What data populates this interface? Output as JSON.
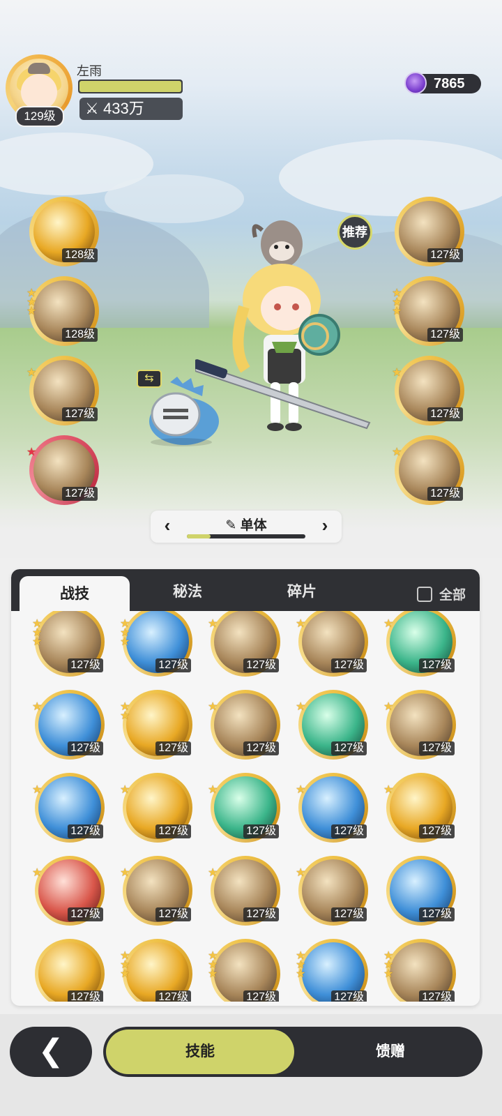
{
  "player": {
    "name": "左雨",
    "level": "129级",
    "hp_fraction": 1.0,
    "power": "433万",
    "power_icon": "crossed-swords-icon"
  },
  "currency": {
    "value": "7865",
    "icon": "purple-gem-icon"
  },
  "recommend_label": "推荐",
  "left_skills": [
    {
      "level": "128级",
      "stars": 0,
      "icon": "golden-crystal-icon",
      "frame": "gold"
    },
    {
      "level": "128级",
      "stars": 3,
      "icon": "fire-swirl-icon",
      "frame": "gold"
    },
    {
      "level": "127级",
      "stars": 1,
      "icon": "dash-strike-icon",
      "frame": "gold"
    },
    {
      "level": "127级",
      "stars": 1,
      "icon": "whirlwind-icon",
      "frame": "red"
    }
  ],
  "right_skills": [
    {
      "level": "127级",
      "stars": 0,
      "icon": "ring-guard-icon"
    },
    {
      "level": "127级",
      "stars": 3,
      "icon": "beast-claw-icon"
    },
    {
      "level": "127级",
      "stars": 1,
      "icon": "fist-strike-icon"
    },
    {
      "level": "127级",
      "stars": 1,
      "icon": "stone-fist-icon"
    }
  ],
  "mode": {
    "label": "单体",
    "progress": 0.2,
    "edit_icon": "pencil-icon"
  },
  "tabs": [
    {
      "label": "战技",
      "active": true
    },
    {
      "label": "秘法",
      "active": false
    },
    {
      "label": "碎片",
      "active": false
    }
  ],
  "all_toggle_label": "全部",
  "grid_skills": [
    {
      "level": "127级",
      "stars": 3,
      "icon": "crushing-pillar-icon",
      "tone": "brown"
    },
    {
      "level": "127级",
      "stars": 3,
      "icon": "blue-rune-ring-icon",
      "tone": "blue"
    },
    {
      "level": "127级",
      "stars": 1,
      "icon": "sand-slash-icon",
      "tone": "brown"
    },
    {
      "level": "127级",
      "stars": 1,
      "icon": "spiral-wind-icon",
      "tone": "brown"
    },
    {
      "level": "127级",
      "stars": 1,
      "icon": "green-web-icon",
      "tone": "green"
    },
    {
      "level": "127级",
      "stars": 1,
      "icon": "ice-burst-icon",
      "tone": "blue"
    },
    {
      "level": "127级",
      "stars": 2,
      "icon": "golden-blade-icon",
      "tone": "gold"
    },
    {
      "level": "127级",
      "stars": 1,
      "icon": "crescent-cut-icon",
      "tone": "brown"
    },
    {
      "level": "127级",
      "stars": 1,
      "icon": "green-comet-icon",
      "tone": "green"
    },
    {
      "level": "127级",
      "stars": 1,
      "icon": "thrust-strike-icon",
      "tone": "brown"
    },
    {
      "level": "127级",
      "stars": 1,
      "icon": "blue-vortex-icon",
      "tone": "blue"
    },
    {
      "level": "127级",
      "stars": 1,
      "icon": "golden-star-icon",
      "tone": "gold"
    },
    {
      "level": "127级",
      "stars": 1,
      "icon": "green-sword-icon",
      "tone": "green"
    },
    {
      "level": "127级",
      "stars": 1,
      "icon": "blue-orb-icon",
      "tone": "blue"
    },
    {
      "level": "127级",
      "stars": 1,
      "icon": "golden-horn-icon",
      "tone": "gold"
    },
    {
      "level": "127级",
      "stars": 1,
      "icon": "red-sword-icon",
      "tone": "red"
    },
    {
      "level": "127级",
      "stars": 1,
      "icon": "explosion-icon",
      "tone": "brown"
    },
    {
      "level": "127级",
      "stars": 1,
      "icon": "beast-head-icon",
      "tone": "brown"
    },
    {
      "level": "127级",
      "stars": 1,
      "icon": "sparkle-slash-icon",
      "tone": "brown"
    },
    {
      "level": "127级",
      "stars": 0,
      "icon": "water-wave-icon",
      "tone": "blue"
    },
    {
      "level": "127级",
      "stars": 0,
      "icon": "golden-nova-icon",
      "tone": "gold"
    },
    {
      "level": "127级",
      "stars": 3,
      "icon": "golden-sigil-icon",
      "tone": "gold"
    },
    {
      "level": "127级",
      "stars": 3,
      "icon": "flame-pillars-icon",
      "tone": "brown"
    },
    {
      "level": "127级",
      "stars": 3,
      "icon": "blue-star-shield-icon",
      "tone": "blue"
    },
    {
      "level": "127级",
      "stars": 3,
      "icon": "golden-fist-icon",
      "tone": "brown"
    }
  ],
  "bottom": {
    "back_icon": "chevron-left-icon",
    "active_label": "技能",
    "inactive_label": "馈赠"
  },
  "colors": {
    "accent": "#cfd36a",
    "dark": "#2f3034",
    "gold_frame": "#efc248",
    "red_frame": "#e35a6d"
  }
}
